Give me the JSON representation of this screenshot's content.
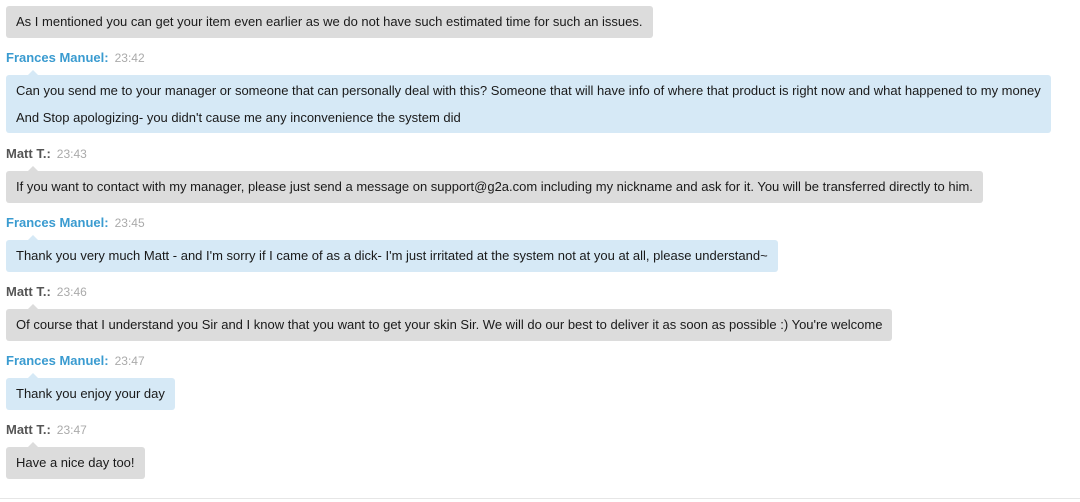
{
  "messages": [
    {
      "sender": "",
      "time": "",
      "role": "agent",
      "lines": [
        "As I mentioned you can get your item even earlier as we do not have such estimated time for such an issues."
      ]
    },
    {
      "sender": "Frances Manuel:",
      "time": "23:42",
      "role": "customer",
      "lines": [
        "Can you send me to your manager or someone that can personally deal with this? Someone that will have info of where that product is right now and what happened to my money",
        "And Stop apologizing- you didn't cause me any inconvenience the system did"
      ]
    },
    {
      "sender": "Matt T.:",
      "time": "23:43",
      "role": "agent",
      "lines": [
        "If you want to contact with my manager, please just send a message on support@g2a.com including my nickname and ask for it. You will be transferred directly to him."
      ]
    },
    {
      "sender": "Frances Manuel:",
      "time": "23:45",
      "role": "customer",
      "lines": [
        "Thank you very much Matt - and I'm sorry if I came of as a dick- I'm just irritated at the system not at you at all, please understand~"
      ]
    },
    {
      "sender": "Matt T.:",
      "time": "23:46",
      "role": "agent",
      "lines": [
        "Of course that I understand you Sir and I know that you want to get your skin Sir. We will do our best to deliver it as soon as possible :) You're welcome"
      ]
    },
    {
      "sender": "Frances Manuel:",
      "time": "23:47",
      "role": "customer",
      "lines": [
        "Thank you enjoy your day"
      ]
    },
    {
      "sender": "Matt T.:",
      "time": "23:47",
      "role": "agent",
      "lines": [
        "Have a nice day too!"
      ]
    }
  ]
}
